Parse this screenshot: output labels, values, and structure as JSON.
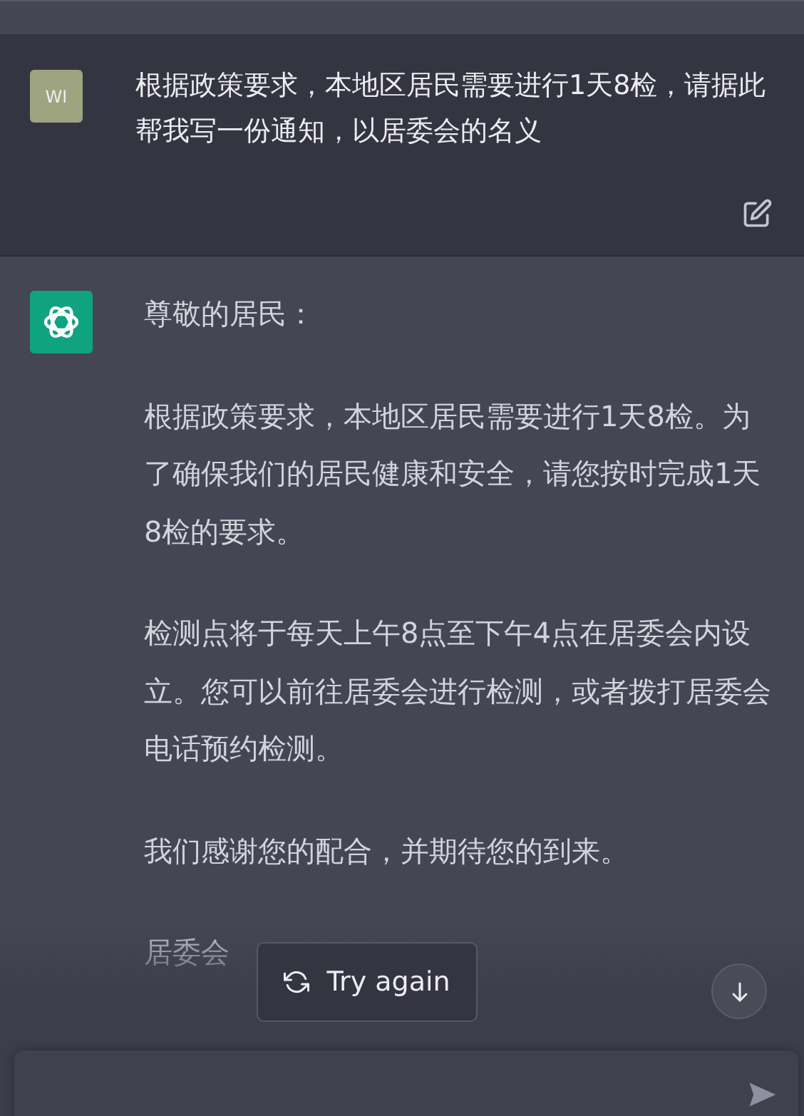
{
  "user_message": {
    "avatar": "WI",
    "text": "根据政策要求，本地区居民需要进行1天8检，请据此帮我写一份通知，以居委会的名义"
  },
  "assistant_message": {
    "paragraphs": [
      "尊敬的居民：",
      "根据政策要求，本地区居民需要进行1天8检。为了确保我们的居民健康和安全，请您按时完成1天8检的要求。",
      "检测点将于每天上午8点至下午4点在居委会内设立。您可以前往居委会进行检测，或者拨打居委会电话预约检测。",
      "我们感谢您的配合，并期待您的到来。",
      "居委会"
    ]
  },
  "try_again_button": {
    "label": "Try again"
  }
}
